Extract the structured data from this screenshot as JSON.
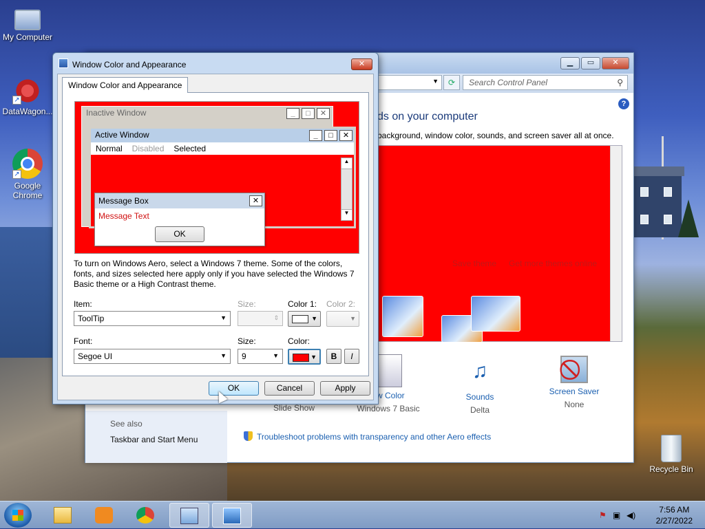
{
  "desktop": {
    "icons": [
      {
        "label": "My Computer"
      },
      {
        "label": "DataWagon..."
      },
      {
        "label": "Google Chrome"
      },
      {
        "label": "Recycle Bin"
      }
    ]
  },
  "control_panel": {
    "search_placeholder": "Search Control Panel",
    "heading": "ds on your computer",
    "subtitle": "background, window color, sounds, and screen saver all at once.",
    "save_theme": "Save theme",
    "get_more_themes": "Get more themes online",
    "see_also": "See also",
    "taskbar_link": "Taskbar and Start Menu",
    "categories": [
      {
        "title": "ow Color",
        "subtitle": "Windows 7 Basic"
      },
      {
        "title": "Sounds",
        "subtitle": "Delta"
      },
      {
        "title": "Screen Saver",
        "subtitle": "None"
      }
    ],
    "slideshow": "Slide Show",
    "troubleshoot": "Troubleshoot problems with transparency and other Aero effects"
  },
  "dialog": {
    "title": "Window Color and Appearance",
    "tab": "Window Color and Appearance",
    "preview": {
      "inactive": "Inactive Window",
      "active": "Active Window",
      "menu": [
        "Normal",
        "Disabled",
        "Selected"
      ],
      "message_box": "Message Box",
      "message_text": "Message Text",
      "ok": "OK"
    },
    "note": "To turn on Windows Aero, select a Windows 7 theme.  Some of the colors, fonts, and sizes selected here apply only if you have selected the Windows 7 Basic theme or a High Contrast theme.",
    "item_label": "Item:",
    "item_value": "ToolTip",
    "size_label": "Size:",
    "color1_label": "Color 1:",
    "color2_label": "Color 2:",
    "font_label": "Font:",
    "font_value": "Segoe UI",
    "font_size_label": "Size:",
    "font_size_value": "9",
    "font_color_label": "Color:",
    "bold": "B",
    "italic": "I",
    "color1_swatch": "#ffffff",
    "font_color_swatch": "#ff0000",
    "buttons": {
      "ok": "OK",
      "cancel": "Cancel",
      "apply": "Apply"
    }
  },
  "taskbar": {
    "time": "7:56 AM",
    "date": "2/27/2022"
  },
  "colors": {
    "preview_bg": "#ff0000",
    "accent": "#1a5fb0"
  }
}
